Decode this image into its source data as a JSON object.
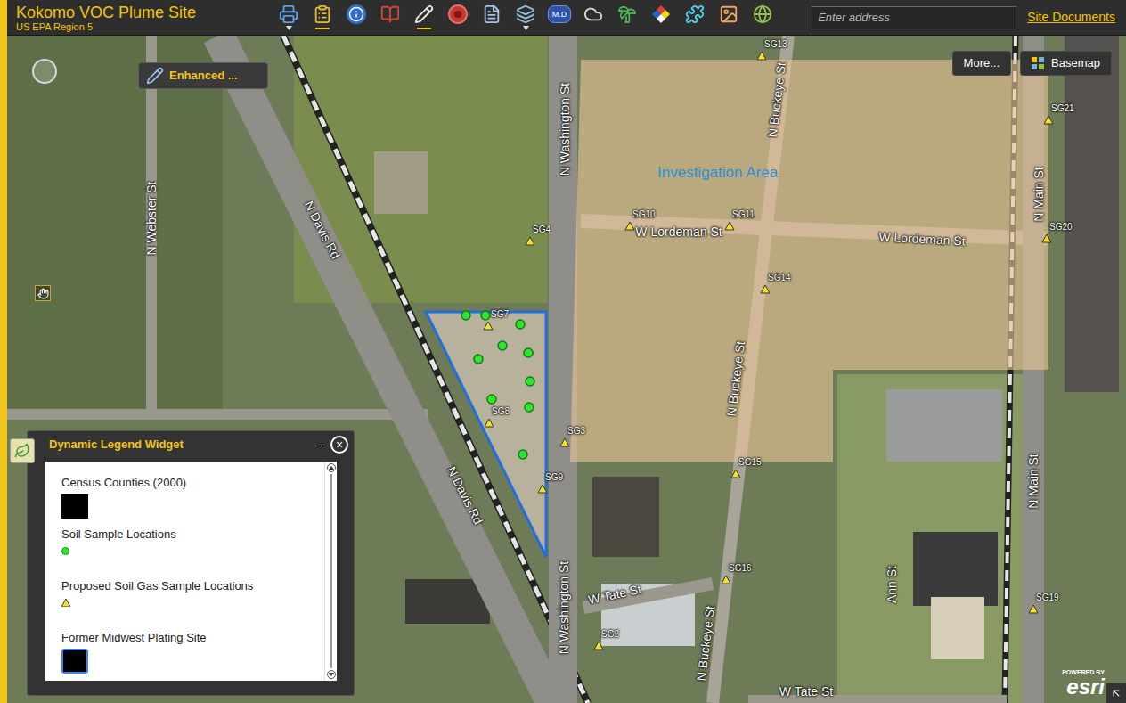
{
  "app": {
    "title": "Kokomo VOC Plume Site",
    "subtitle": "US EPA Region 5"
  },
  "toolbar": [
    {
      "kind": "print",
      "menu": true,
      "underlined": false
    },
    {
      "kind": "report",
      "menu": false,
      "underlined": true
    },
    {
      "kind": "info",
      "menu": false,
      "underlined": false
    },
    {
      "kind": "book",
      "menu": false,
      "underlined": false
    },
    {
      "kind": "draw",
      "menu": false,
      "underlined": true
    },
    {
      "kind": "record",
      "menu": false,
      "underlined": false
    },
    {
      "kind": "document",
      "menu": false,
      "underlined": false
    },
    {
      "kind": "layers",
      "menu": true,
      "underlined": false
    },
    {
      "kind": "badge",
      "label": "M.D",
      "menu": false,
      "underlined": false
    },
    {
      "kind": "weather",
      "menu": false,
      "underlined": false
    },
    {
      "kind": "palm",
      "menu": false,
      "underlined": false
    },
    {
      "kind": "hazard",
      "menu": false,
      "underlined": false
    },
    {
      "kind": "puzzle",
      "menu": false,
      "underlined": false
    },
    {
      "kind": "chart",
      "menu": false,
      "underlined": false
    },
    {
      "kind": "globe",
      "menu": false,
      "underlined": false
    }
  ],
  "search": {
    "placeholder": "Enter address"
  },
  "header_link": "Site Documents",
  "edit_button": "Enhanced ...",
  "map_buttons": [
    {
      "label": "More...",
      "kind": "text"
    },
    {
      "label": "Basemap",
      "kind": "grid"
    }
  ],
  "map": {
    "area_label": "Investigation Area",
    "streets": [
      "N Webster St",
      "N Davis Rd",
      "N Davis Rd",
      "N Washington St",
      "N Washington St",
      "W Lordeman St",
      "W Lordeman St",
      "N Buckeye St",
      "N Buckeye St",
      "N Buckeye St",
      "N Main St",
      "N Main St",
      "W Tate St",
      "Ann St",
      "W Tate St"
    ],
    "soil_gas_points": [
      "SG13",
      "SG21",
      "SG4",
      "SG10",
      "SG11",
      "SG20",
      "SG14",
      "SG7",
      "SG8",
      "SG3",
      "SG9",
      "SG15",
      "SG16",
      "SG2",
      "SG19"
    ]
  },
  "legend": {
    "title": "Dynamic Legend Widget",
    "minimize": "–",
    "close": "×",
    "items": [
      {
        "label": "Census Counties (2000)",
        "kind": "square"
      },
      {
        "label": "Soil Sample Locations",
        "kind": "dot"
      },
      {
        "label": "Proposed Soil Gas Sample Locations",
        "kind": "triangle"
      },
      {
        "label": "Former Midwest Plating Site",
        "kind": "outlined-square"
      }
    ]
  },
  "attribution": {
    "powered_by": "POWERED BY",
    "brand": "esri"
  }
}
